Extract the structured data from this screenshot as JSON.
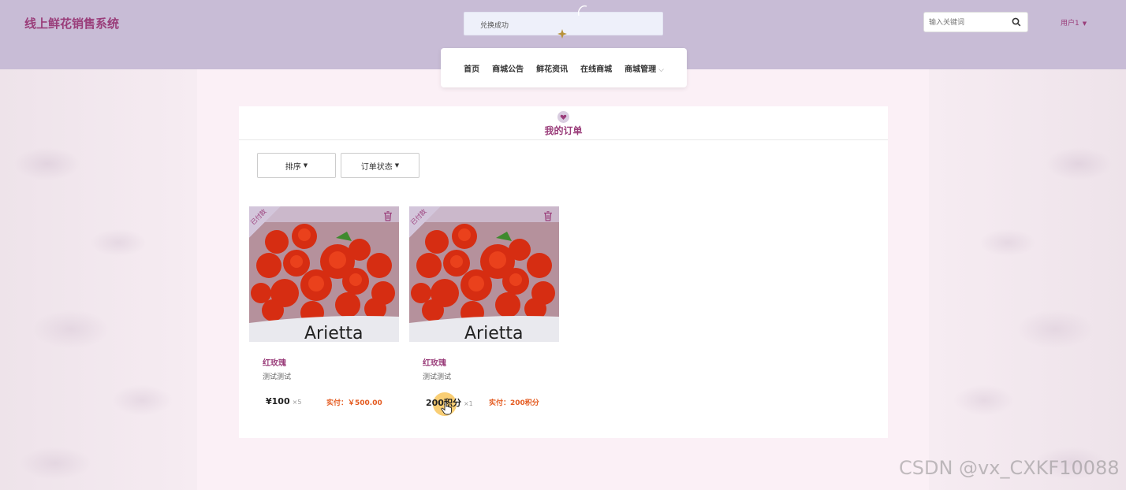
{
  "header": {
    "site_title": "线上鲜花销售系统",
    "toast": "兑换成功",
    "search_placeholder": "输入关键词",
    "user_label": "用户1"
  },
  "nav": {
    "items": [
      {
        "label": "首页"
      },
      {
        "label": "商城公告"
      },
      {
        "label": "鲜花资讯"
      },
      {
        "label": "在线商城"
      },
      {
        "label": "商城管理"
      }
    ]
  },
  "panel": {
    "title": "我的订单",
    "filters": {
      "sort_label": "排序",
      "status_label": "订单状态"
    }
  },
  "orders": [
    {
      "status_badge": "已付款",
      "name": "红玫瑰",
      "description": "测试测试",
      "price": "¥100",
      "quantity": "×5",
      "paid": "实付：￥500.00",
      "image_text": "Arietta"
    },
    {
      "status_badge": "已付款",
      "name": "红玫瑰",
      "description": "测试测试",
      "price": "200积分",
      "quantity": "×1",
      "paid": "实付：200积分",
      "image_text": "Arietta"
    }
  ],
  "watermark": "CSDN @vx_CXKF10088",
  "colors": {
    "header_bg": "#c8bcd6",
    "brand": "#9a3d7a",
    "paid_text": "#e45b20"
  }
}
